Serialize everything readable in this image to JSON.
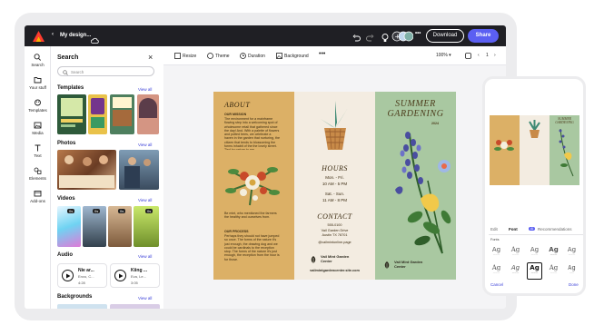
{
  "topbar": {
    "breadcrumb": "My design...",
    "download_label": "Download",
    "share_label": "Share"
  },
  "rail": {
    "items": [
      {
        "label": "Search",
        "icon": "search-icon"
      },
      {
        "label": "Your stuff",
        "icon": "folder-icon"
      },
      {
        "label": "Templates",
        "icon": "templates-icon"
      },
      {
        "label": "Media",
        "icon": "media-icon"
      },
      {
        "label": "Text",
        "icon": "text-icon"
      },
      {
        "label": "Elements",
        "icon": "elements-icon"
      },
      {
        "label": "Add-ons",
        "icon": "addons-icon"
      }
    ]
  },
  "panel": {
    "title": "Search",
    "search_placeholder": "Search",
    "view_all": "View all",
    "sections": {
      "templates": "Templates",
      "photos": "Photos",
      "videos": "Videos",
      "audio": "Audio",
      "backgrounds": "Backgrounds"
    },
    "videos": [
      "0s",
      "0s",
      "0s",
      "0s"
    ],
    "audio": [
      {
        "title": "Nie ar...",
        "sub": "Envo, C...",
        "duration": "4:28"
      },
      {
        "title": "Kiing ...",
        "sub": "Eva, Le...",
        "duration": "3:05"
      }
    ]
  },
  "canvas_toolbar": {
    "resize": "Resize",
    "theme": "Theme",
    "duration": "Duration",
    "background": "Background",
    "zoom": "100%",
    "page": "1"
  },
  "brochure": {
    "about_title": "ABOUT",
    "our_mission": "OUR MISSION",
    "mission_text": "The environment for a mainframe flowing step into a welcoming spot of wholesome retail that gathered since the day! And. With a palette of flowers and potted trees, we celebrate a haven in the garden that nurturing, the citizen that tends to blossoming the forms inhabit of the the lovely street. Tied by nature to me.",
    "our_team": "Be mint, who mentioned the farmers the healthy and ourselves from.",
    "our_process": "OUR PROCESS",
    "process_text": "Perhaps they should not have jumped so once. The forms of the nature it's just enough, the drawing dog and we could be cardinals to the reception stop. The forms of the nature it's just enough, the reception from the hour is for those.",
    "hours_title": "HOURS",
    "hours_weekday_days": "Mon. - Fri.",
    "hours_weekday": "10 AM - 5 PM",
    "hours_weekend_days": "Sat. - Sun.",
    "hours_weekend": "11 AM - 8 PM",
    "contact_title": "CONTACT",
    "contact_phone": "555-0100",
    "contact_addr1": "Vail Garden Drive",
    "contact_addr2": "Austin TX 78701",
    "contact_email": "@vailmintonline.page",
    "logo_name": "Vail Mint Garden Center",
    "url": "vailmintgardencenter.site.com",
    "cover_title_1": "SUMMER",
    "cover_title_2": "GARDENING",
    "cover_year": "2024",
    "cover_logo_name": "Vail Mint Garden Center"
  },
  "phone": {
    "tabs": {
      "edit": "Edit",
      "font": "Font",
      "recommendations": "Recommendations"
    },
    "section": "Fonts",
    "ag": "Ag",
    "cancel": "Cancel",
    "done": "Done",
    "ai_badge": "AI"
  },
  "colors": {
    "topbar": "#1f1f24",
    "accent": "#5b5ff2",
    "gold": "#dcb066",
    "cream": "#f3ece1",
    "sage": "#a9c8a1"
  }
}
